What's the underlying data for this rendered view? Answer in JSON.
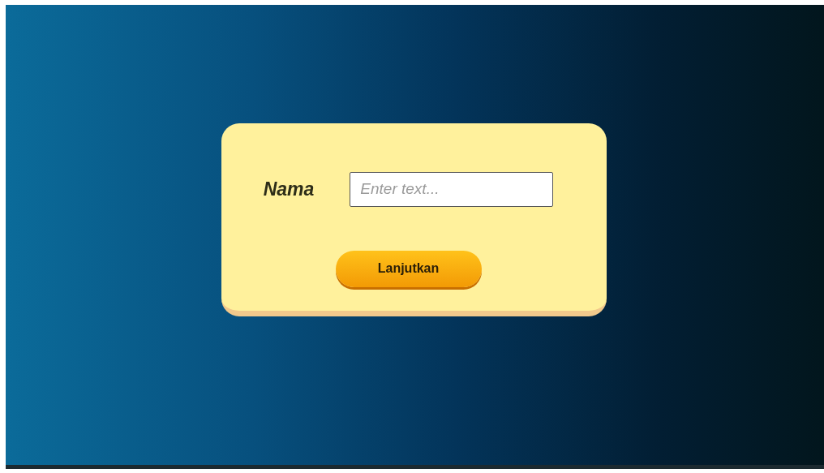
{
  "form": {
    "label": "Nama",
    "input": {
      "placeholder": "Enter text..."
    },
    "button": "Lanjutkan"
  }
}
